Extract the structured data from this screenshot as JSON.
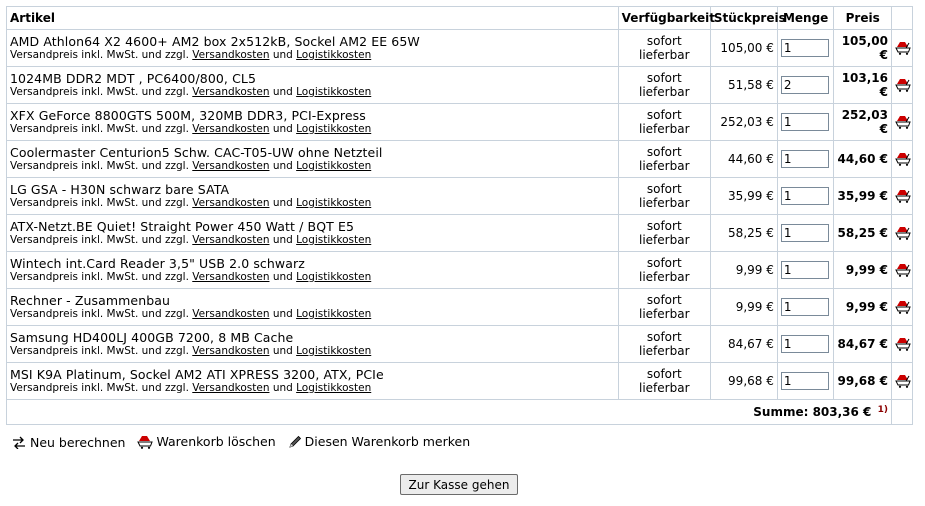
{
  "table": {
    "headers": {
      "article": "Artikel",
      "availability": "Verfügbarkeit",
      "unit_price": "Stückpreis",
      "quantity": "Menge",
      "price": "Preis"
    },
    "rows": [
      {
        "name": "AMD Athlon64 X2 4600+ AM2 box 2x512kB, Sockel AM2 EE 65W",
        "availability": "sofort lieferbar",
        "unit_price": "105,00 €",
        "quantity": "1",
        "price": "105,00 €"
      },
      {
        "name": "1024MB DDR2 MDT , PC6400/800, CL5",
        "availability": "sofort lieferbar",
        "unit_price": "51,58 €",
        "quantity": "2",
        "price": "103,16 €"
      },
      {
        "name": "XFX GeForce 8800GTS 500M, 320MB DDR3, PCI-Express",
        "availability": "sofort lieferbar",
        "unit_price": "252,03 €",
        "quantity": "1",
        "price": "252,03 €"
      },
      {
        "name": "Coolermaster Centurion5 Schw. CAC-T05-UW ohne Netzteil",
        "availability": "sofort lieferbar",
        "unit_price": "44,60 €",
        "quantity": "1",
        "price": "44,60 €"
      },
      {
        "name": "LG GSA - H30N schwarz bare SATA",
        "availability": "sofort lieferbar",
        "unit_price": "35,99 €",
        "quantity": "1",
        "price": "35,99 €"
      },
      {
        "name": "ATX-Netzt.BE Quiet! Straight Power 450 Watt / BQT E5",
        "availability": "sofort lieferbar",
        "unit_price": "58,25 €",
        "quantity": "1",
        "price": "58,25 €"
      },
      {
        "name": "Wintech int.Card Reader 3,5\" USB 2.0 schwarz",
        "availability": "sofort lieferbar",
        "unit_price": "9,99 €",
        "quantity": "1",
        "price": "9,99 €"
      },
      {
        "name": "Rechner - Zusammenbau",
        "availability": "sofort lieferbar",
        "unit_price": "9,99 €",
        "quantity": "1",
        "price": "9,99 €"
      },
      {
        "name": "Samsung HD400LJ 400GB 7200, 8 MB Cache",
        "availability": "sofort lieferbar",
        "unit_price": "84,67 €",
        "quantity": "1",
        "price": "84,67 €"
      },
      {
        "name": "MSI K9A Platinum, Sockel AM2 ATI XPRESS 3200, ATX, PCIe",
        "availability": "sofort lieferbar",
        "unit_price": "99,68 €",
        "quantity": "1",
        "price": "99,68 €"
      }
    ],
    "row_note": {
      "prefix": "Versandpreis inkl. MwSt. und zzgl.",
      "shipping_link": "Versandkosten",
      "conjunction": "und",
      "logistics_link": "Logistikkosten"
    },
    "sum": {
      "label": "Summe: 803,36 €",
      "footnote": "1)"
    }
  },
  "actions": {
    "recalculate": "Neu berechnen",
    "clear_cart": "Warenkorb löschen",
    "remember_cart": "Diesen Warenkorb merken"
  },
  "checkout_button": "Zur Kasse gehen",
  "icons": {
    "row_action": "remove-from-cart-icon",
    "recalculate": "recalculate-arrows-icon",
    "clear": "clear-cart-icon",
    "remember": "pencil-icon"
  },
  "colors": {
    "icon_red": "#cc0000",
    "border": "#c8d2dc",
    "footnote": "#8b0000"
  }
}
